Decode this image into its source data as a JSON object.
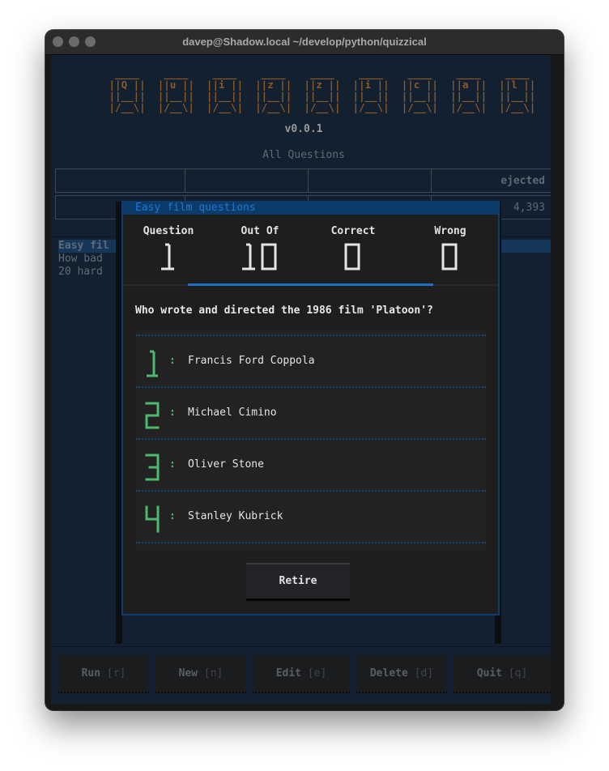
{
  "window": {
    "title": "davep@Shadow.local ~/develop/python/quizzical",
    "traffic_lights": [
      "close",
      "minimize",
      "zoom"
    ]
  },
  "app": {
    "logo_letters": [
      "Q",
      "u",
      "i",
      "z",
      "z",
      "i",
      "c",
      "a",
      "l"
    ],
    "version": "v0.0.1",
    "subtitle": "All Questions",
    "stats_table": {
      "header_visible": "ejected",
      "row_value_visible": "4,393"
    },
    "question_lists": [
      {
        "label": "Easy fil",
        "selected": true
      },
      {
        "label": "How bad",
        "selected": false
      },
      {
        "label": "20 hard",
        "selected": false
      }
    ],
    "footer_buttons": [
      {
        "label": "Run",
        "key": "[r]"
      },
      {
        "label": "New",
        "key": "[n]"
      },
      {
        "label": "Edit",
        "key": "[e]"
      },
      {
        "label": "Delete",
        "key": "[d]"
      },
      {
        "label": "Quit",
        "key": "[q]"
      }
    ]
  },
  "modal": {
    "title": "Easy film questions",
    "scores": [
      {
        "label": "Question",
        "value": "1"
      },
      {
        "label": "Out Of",
        "value": "10"
      },
      {
        "label": "Correct",
        "value": "0"
      },
      {
        "label": "Wrong",
        "value": "0"
      }
    ],
    "progress_fraction": 0.1,
    "question": "Who wrote and directed the 1986 film 'Platoon'?",
    "answers": [
      {
        "number": "1",
        "separator": ":",
        "text": "Francis Ford Coppola"
      },
      {
        "number": "2",
        "separator": ":",
        "text": "Michael Cimino"
      },
      {
        "number": "3",
        "separator": ":",
        "text": "Oliver Stone"
      },
      {
        "number": "4",
        "separator": ":",
        "text": "Stanley Kubrick"
      }
    ],
    "retire_label": "Retire"
  },
  "colors": {
    "accent_blue": "#1f6fc8",
    "answer_green": "#4cb96e",
    "logo_brown": "#8a5a2b",
    "terminal_bg": "#12202f"
  }
}
